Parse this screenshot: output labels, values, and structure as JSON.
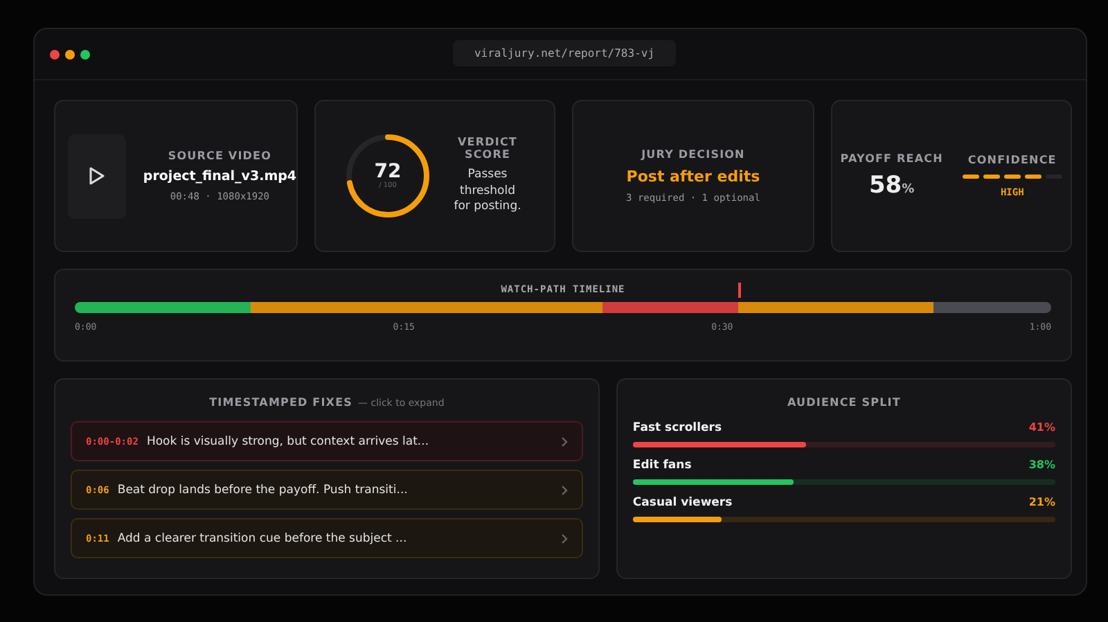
{
  "window": {
    "url": "viraljury.net/report/783-vj"
  },
  "source": {
    "label": "SOURCE VIDEO",
    "filename": "project_final_v3.mp4",
    "meta": "00:48 · 1080x1920"
  },
  "verdict": {
    "score": "72",
    "max": "/ 100",
    "level": 0.72,
    "title": "VERDICT SCORE",
    "note": "Passes threshold for posting."
  },
  "jury": {
    "label": "JURY DECISION",
    "decision": "Post after edits",
    "detail": "3 required · 1 optional"
  },
  "payoff": {
    "label": "PAYOFF REACH",
    "value": "58",
    "unit": "%"
  },
  "confidence": {
    "label": "CONFIDENCE",
    "level": 0.8,
    "reading": "HIGH"
  },
  "timeline": {
    "title": "WATCH-PATH TIMELINE",
    "marker": {
      "level": 0.68
    },
    "segments": [
      {
        "color": "#22b455"
      },
      {
        "color": "#d98a0b"
      },
      {
        "color": "#d13d3d"
      },
      {
        "color": "#d98a0b"
      },
      {
        "color": "#4a4a52"
      }
    ],
    "ticks": [
      "0:00",
      "0:15",
      "0:30",
      "1:00"
    ]
  },
  "fixes": {
    "title": "TIMESTAMPED FIXES",
    "hint": "— click to expand",
    "items": [
      {
        "kind": "critical",
        "time": "0:00-0:02",
        "text": "Hook is visually strong, but context arrives lat..."
      },
      {
        "kind": "warning",
        "time": "0:06",
        "text": "Beat drop lands before the payoff. Push transiti..."
      },
      {
        "kind": "warning",
        "time": "0:11",
        "text": "Add a clearer transition cue before the subject ..."
      }
    ]
  },
  "audience": {
    "title": "AUDIENCE SPLIT",
    "groups": [
      {
        "name": "Fast scrollers",
        "reading": "41%",
        "level": 0.41,
        "color": "#ef4444"
      },
      {
        "name": "Edit fans",
        "reading": "38%",
        "level": 0.38,
        "color": "#22c55e"
      },
      {
        "name": "Casual viewers",
        "reading": "21%",
        "level": 0.21,
        "color": "#f59e0b"
      }
    ]
  }
}
